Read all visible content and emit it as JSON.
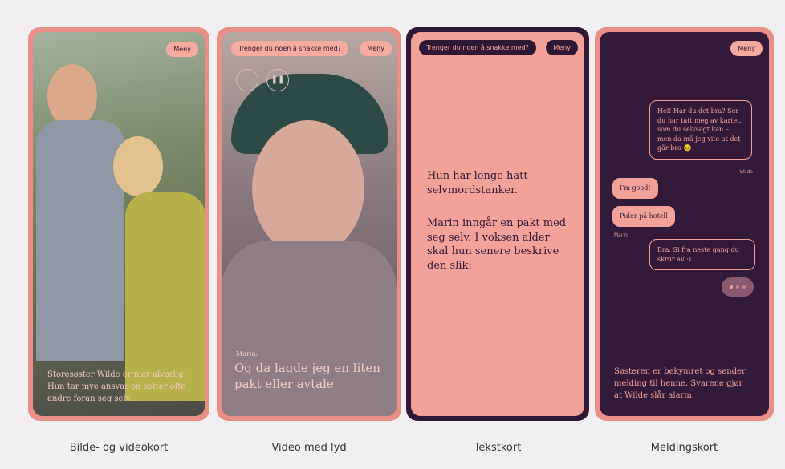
{
  "cards": [
    {
      "menu_label": "Meny",
      "caption": "Storesøster Wilde er mer alvorlig. Hun tar mye ansvar og setter ofte andre foran seg selv.",
      "label": "Bilde- og videokort"
    },
    {
      "question_label": "Trenger du noen å snakke med?",
      "menu_label": "Meny",
      "speaker": "Marin:",
      "caption": "Og da lagde jeg en liten pakt eller avtale",
      "label": "Video med lyd"
    },
    {
      "question_label": "Trenger du noen å snakke med?",
      "menu_label": "Meny",
      "paragraph1": "Hun har lenge hatt selvmordstanker.",
      "paragraph2": "Marin inngår en pakt med seg selv. I voksen alder skal hun senere beskrive den slik:",
      "label": "Tekstkort"
    },
    {
      "menu_label": "Meny",
      "messages": [
        {
          "text": "Hei! Har du det bra? Ser du har tatt meg av kartet, som du selvsagt kan – men da må jeg vite at det går bra 😊",
          "sender": "Wilde"
        },
        {
          "text": "I'm good!"
        },
        {
          "text": "Puler på hotell",
          "sender": "Marin"
        },
        {
          "text": "Bra. Si fra neste gang du skrur av :)"
        }
      ],
      "caption": "Søsteren er bekymret og sender melding til henne. Svarene gjør at Wilde slår alarm.",
      "label": "Meldingskort"
    }
  ]
}
